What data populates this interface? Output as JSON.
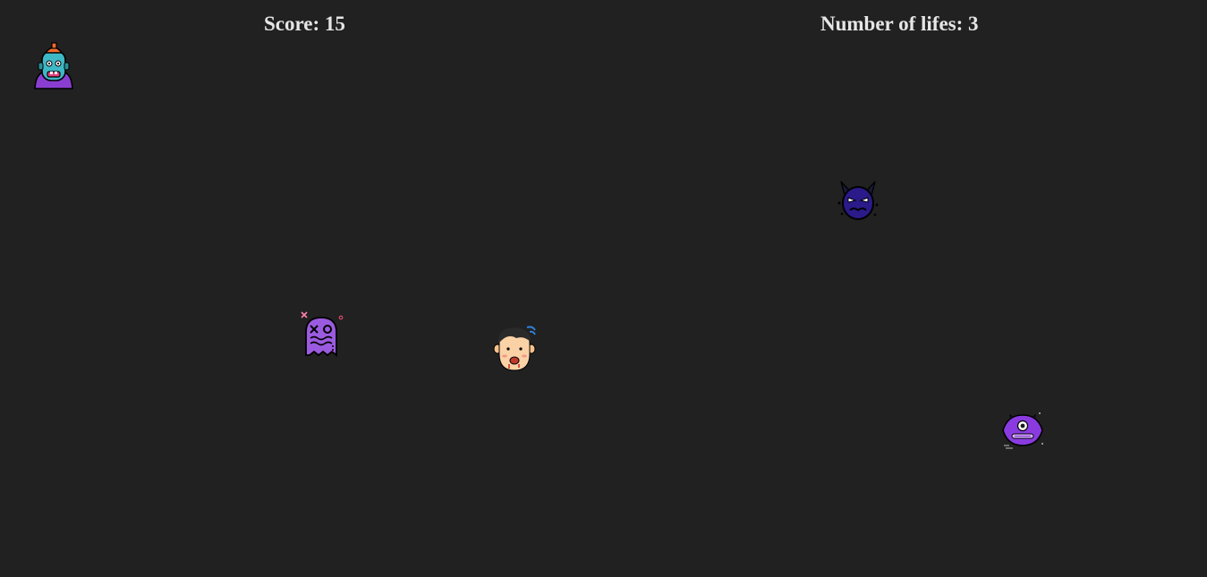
{
  "hud": {
    "score_label": "Score:",
    "score_value": "15",
    "lives_label": "Number of lifes:",
    "lives_value": "3"
  },
  "sprites": {
    "player": "player-face-icon",
    "enemies": [
      "zombie-monster-icon",
      "devil-mask-monster-icon",
      "dead-ghost-monster-icon",
      "cyclops-monster-icon"
    ]
  },
  "colors": {
    "background": "#212121",
    "hud_text": "#e6e6e6"
  }
}
